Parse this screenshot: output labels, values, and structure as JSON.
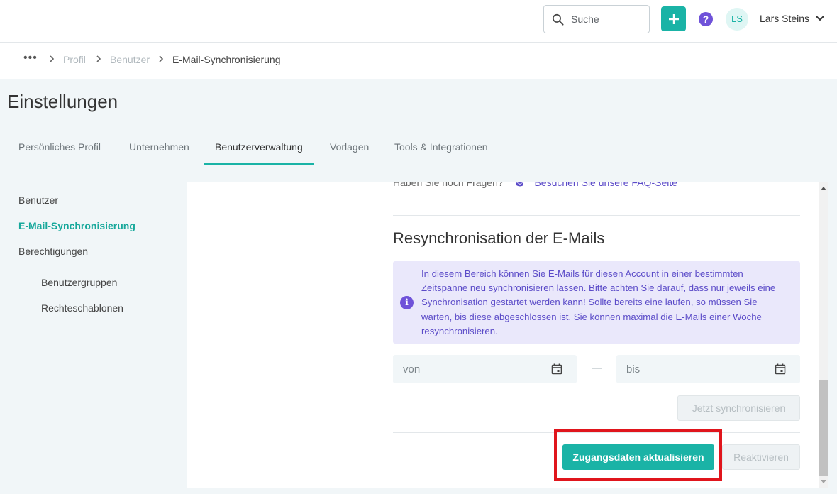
{
  "header": {
    "search": {
      "placeholder": "Suche",
      "icon": "search-icon"
    },
    "add_icon": "plus-icon",
    "help_icon": "?",
    "avatar_initials": "LS",
    "user_name": "Lars Steins",
    "accent_color": "#1ab3a6"
  },
  "breadcrumb": {
    "more": "•••",
    "items": [
      "Profil",
      "Benutzer",
      "E-Mail-Synchronisierung"
    ]
  },
  "page": {
    "title": "Einstellungen"
  },
  "tabs": [
    {
      "label": "Persönliches Profil",
      "active": false
    },
    {
      "label": "Unternehmen",
      "active": false
    },
    {
      "label": "Benutzerverwaltung",
      "active": true
    },
    {
      "label": "Vorlagen",
      "active": false
    },
    {
      "label": "Tools & Integrationen",
      "active": false
    }
  ],
  "sidebar": {
    "items": [
      {
        "label": "Benutzer",
        "active": false
      },
      {
        "label": "E-Mail-Synchronisierung",
        "active": true
      },
      {
        "label": "Berechtigungen",
        "active": false
      },
      {
        "label": "Benutzergruppen",
        "active": false,
        "sub": true
      },
      {
        "label": "Rechteschablonen",
        "active": false,
        "sub": true
      }
    ]
  },
  "content": {
    "faq_question": "Haben Sie noch Fragen?",
    "faq_link": "Besuchen Sie unsere FAQ-Seite",
    "resync": {
      "title": "Resynchronisation der E-Mails",
      "info_icon": "i",
      "info_text": "In diesem Bereich können Sie E-Mails für diesen Account in einer bestimmten Zeitspanne neu synchronisieren lassen. Bitte achten Sie darauf, dass nur jeweils eine Synchronisation gestartet werden kann! Sollte bereits eine laufen, so müssen Sie warten, bis diese abgeschlossen ist. Sie können maximal die E-Mails einer Woche resynchronisieren.",
      "from_placeholder": "von",
      "to_placeholder": "bis",
      "sync_button": "Jetzt synchronisieren"
    },
    "update_credentials_button": "Zugangsdaten aktualisieren",
    "reactivate_button": "Reaktivieren"
  }
}
